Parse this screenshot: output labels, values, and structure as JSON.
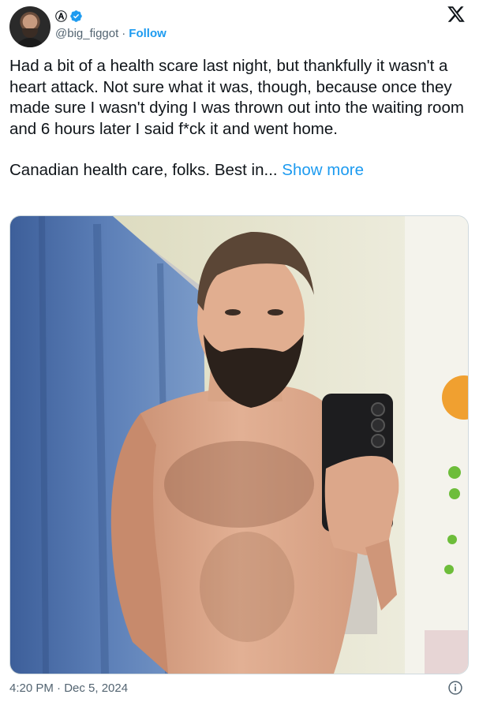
{
  "author": {
    "display_name": "Ⓐ",
    "handle": "@big_figgot",
    "separator": "·",
    "follow_label": "Follow"
  },
  "tweet": {
    "paragraph1": "Had a bit of a health scare last night, but thankfully it wasn't a heart attack. Not sure what it was, though, because once they made sure I wasn't dying I was thrown out into the waiting room and 6 hours later I said f*ck it and went home.",
    "paragraph2": "Canadian health care, folks. Best in...",
    "show_more": "Show more"
  },
  "footer": {
    "timestamp": "4:20 PM · Dec 5, 2024"
  },
  "colors": {
    "accent": "#1d9bf0",
    "secondary_text": "#536471",
    "primary_text": "#0f1419"
  },
  "icons": [
    "verified-badge-icon",
    "x-logo-icon",
    "info-icon"
  ]
}
